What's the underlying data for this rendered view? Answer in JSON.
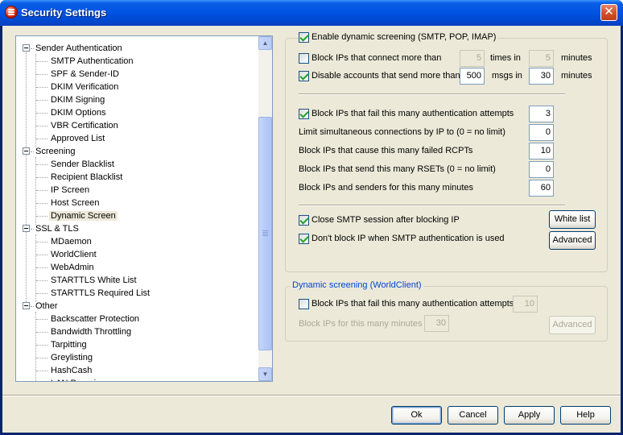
{
  "window": {
    "title": "Security Settings",
    "close_glyph": "✕"
  },
  "tree": {
    "nodes": [
      {
        "label": "Sender Authentication",
        "level": 0
      },
      {
        "label": "SMTP Authentication",
        "level": 1
      },
      {
        "label": "SPF & Sender-ID",
        "level": 1
      },
      {
        "label": "DKIM Verification",
        "level": 1
      },
      {
        "label": "DKIM Signing",
        "level": 1
      },
      {
        "label": "DKIM Options",
        "level": 1
      },
      {
        "label": "VBR Certification",
        "level": 1
      },
      {
        "label": "Approved List",
        "level": 1
      },
      {
        "label": "Screening",
        "level": 0
      },
      {
        "label": "Sender Blacklist",
        "level": 1
      },
      {
        "label": "Recipient Blacklist",
        "level": 1
      },
      {
        "label": "IP Screen",
        "level": 1
      },
      {
        "label": "Host Screen",
        "level": 1
      },
      {
        "label": "Dynamic Screen",
        "level": 1,
        "selected": true
      },
      {
        "label": "SSL & TLS",
        "level": 0
      },
      {
        "label": "MDaemon",
        "level": 1
      },
      {
        "label": "WorldClient",
        "level": 1
      },
      {
        "label": "WebAdmin",
        "level": 1
      },
      {
        "label": "STARTTLS White List",
        "level": 1
      },
      {
        "label": "STARTTLS Required List",
        "level": 1
      },
      {
        "label": "Other",
        "level": 0
      },
      {
        "label": "Backscatter Protection",
        "level": 1
      },
      {
        "label": "Bandwidth Throttling",
        "level": 1
      },
      {
        "label": "Tarpitting",
        "level": 1
      },
      {
        "label": "Greylisting",
        "level": 1
      },
      {
        "label": "HashCash",
        "level": 1
      },
      {
        "label": "LAN Domains",
        "level": 1
      }
    ]
  },
  "smtp_group": {
    "enable_label": "Enable dynamic screening (SMTP, POP, IMAP)",
    "enable_checked": true,
    "block_connect": {
      "label": "Block IPs that connect more than",
      "checked": false,
      "count": "5",
      "times_label": "times in",
      "minutes": "5",
      "minutes_label": "minutes"
    },
    "disable_accounts": {
      "label": "Disable accounts that send more than",
      "checked": true,
      "count": "500",
      "msgs_label": "msgs in",
      "minutes": "30",
      "minutes_label": "minutes"
    },
    "block_auth": {
      "label": "Block IPs that fail this many authentication attempts",
      "checked": true,
      "value": "3"
    },
    "limit_conn": {
      "label": "Limit simultaneous connections by IP to (0 = no limit)",
      "value": "0"
    },
    "failed_rcpts": {
      "label": "Block IPs that cause this many failed RCPTs",
      "value": "10"
    },
    "rsets": {
      "label": "Block IPs that send this many RSETs (0 = no limit)",
      "value": "0"
    },
    "block_minutes": {
      "label": "Block IPs and senders for this many minutes",
      "value": "60"
    },
    "close_session": {
      "label": "Close SMTP session after blocking IP",
      "checked": true
    },
    "dont_block": {
      "label": "Don't block IP when SMTP authentication is used",
      "checked": true
    },
    "white_list_label": "White list",
    "advanced_label": "Advanced"
  },
  "wc_group": {
    "title": "Dynamic screening (WorldClient)",
    "block_auth": {
      "label": "Block IPs that fail this many authentication attempts",
      "checked": false,
      "value": "10"
    },
    "block_minutes": {
      "label": "Block IPs for this many minutes",
      "value": "30"
    },
    "advanced_label": "Advanced"
  },
  "buttons": {
    "ok": "Ok",
    "cancel": "Cancel",
    "apply": "Apply",
    "help": "Help"
  },
  "colors": {
    "title_bar": "#0054e3",
    "dialog_bg": "#ece9d8",
    "group_title_blue": "#0046d5"
  }
}
